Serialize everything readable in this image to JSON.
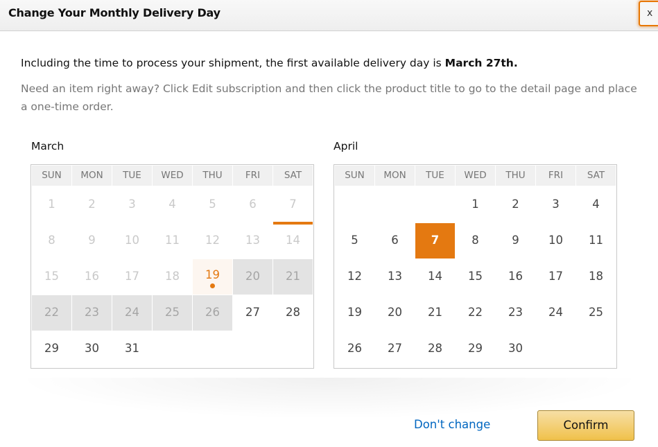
{
  "dialog": {
    "title": "Change Your Monthly Delivery Day",
    "close_label": "x"
  },
  "intro": {
    "text": "Including the time to process your shipment, the first available delivery day is ",
    "date": "March 27th."
  },
  "note": "Need an item right away? Click Edit subscription and then click the product title to go to the detail page and place a one-time order.",
  "weekdays": [
    "SUN",
    "MON",
    "TUE",
    "WED",
    "THU",
    "FRI",
    "SAT"
  ],
  "calendars": [
    {
      "month": "March",
      "weeks": [
        [
          {
            "d": "1",
            "s": "disabled"
          },
          {
            "d": "2",
            "s": "disabled"
          },
          {
            "d": "3",
            "s": "disabled"
          },
          {
            "d": "4",
            "s": "disabled"
          },
          {
            "d": "5",
            "s": "disabled"
          },
          {
            "d": "6",
            "s": "disabled"
          },
          {
            "d": "7",
            "s": "disabled marked"
          }
        ],
        [
          {
            "d": "8",
            "s": "disabled"
          },
          {
            "d": "9",
            "s": "disabled"
          },
          {
            "d": "10",
            "s": "disabled"
          },
          {
            "d": "11",
            "s": "disabled"
          },
          {
            "d": "12",
            "s": "disabled"
          },
          {
            "d": "13",
            "s": "disabled"
          },
          {
            "d": "14",
            "s": "disabled"
          }
        ],
        [
          {
            "d": "15",
            "s": "disabled"
          },
          {
            "d": "16",
            "s": "disabled"
          },
          {
            "d": "17",
            "s": "disabled"
          },
          {
            "d": "18",
            "s": "disabled"
          },
          {
            "d": "19",
            "s": "current"
          },
          {
            "d": "20",
            "s": "blocked"
          },
          {
            "d": "21",
            "s": "blocked"
          }
        ],
        [
          {
            "d": "22",
            "s": "blocked"
          },
          {
            "d": "23",
            "s": "blocked"
          },
          {
            "d": "24",
            "s": "blocked"
          },
          {
            "d": "25",
            "s": "blocked"
          },
          {
            "d": "26",
            "s": "blocked"
          },
          {
            "d": "27",
            "s": "available"
          },
          {
            "d": "28",
            "s": "available"
          }
        ],
        [
          {
            "d": "29",
            "s": "available"
          },
          {
            "d": "30",
            "s": "available"
          },
          {
            "d": "31",
            "s": "available"
          },
          {
            "d": "",
            "s": "empty"
          },
          {
            "d": "",
            "s": "empty"
          },
          {
            "d": "",
            "s": "empty"
          },
          {
            "d": "",
            "s": "empty"
          }
        ]
      ]
    },
    {
      "month": "April",
      "weeks": [
        [
          {
            "d": "",
            "s": "empty"
          },
          {
            "d": "",
            "s": "empty"
          },
          {
            "d": "",
            "s": "empty"
          },
          {
            "d": "1",
            "s": "available"
          },
          {
            "d": "2",
            "s": "available"
          },
          {
            "d": "3",
            "s": "available"
          },
          {
            "d": "4",
            "s": "available"
          }
        ],
        [
          {
            "d": "5",
            "s": "available"
          },
          {
            "d": "6",
            "s": "available"
          },
          {
            "d": "7",
            "s": "selected"
          },
          {
            "d": "8",
            "s": "available"
          },
          {
            "d": "9",
            "s": "available"
          },
          {
            "d": "10",
            "s": "available"
          },
          {
            "d": "11",
            "s": "available"
          }
        ],
        [
          {
            "d": "12",
            "s": "available"
          },
          {
            "d": "13",
            "s": "available"
          },
          {
            "d": "14",
            "s": "available"
          },
          {
            "d": "15",
            "s": "available"
          },
          {
            "d": "16",
            "s": "available"
          },
          {
            "d": "17",
            "s": "available"
          },
          {
            "d": "18",
            "s": "available"
          }
        ],
        [
          {
            "d": "19",
            "s": "available"
          },
          {
            "d": "20",
            "s": "available"
          },
          {
            "d": "21",
            "s": "available"
          },
          {
            "d": "22",
            "s": "available"
          },
          {
            "d": "23",
            "s": "available"
          },
          {
            "d": "24",
            "s": "available"
          },
          {
            "d": "25",
            "s": "available"
          }
        ],
        [
          {
            "d": "26",
            "s": "available"
          },
          {
            "d": "27",
            "s": "available"
          },
          {
            "d": "28",
            "s": "available"
          },
          {
            "d": "29",
            "s": "available"
          },
          {
            "d": "30",
            "s": "available"
          },
          {
            "d": "",
            "s": "empty"
          },
          {
            "d": "",
            "s": "empty"
          }
        ]
      ]
    }
  ],
  "actions": {
    "dont_change": "Don't change",
    "confirm": "Confirm"
  },
  "colors": {
    "accent": "#e47911",
    "link": "#0066c0",
    "button": "#f0c14b"
  }
}
